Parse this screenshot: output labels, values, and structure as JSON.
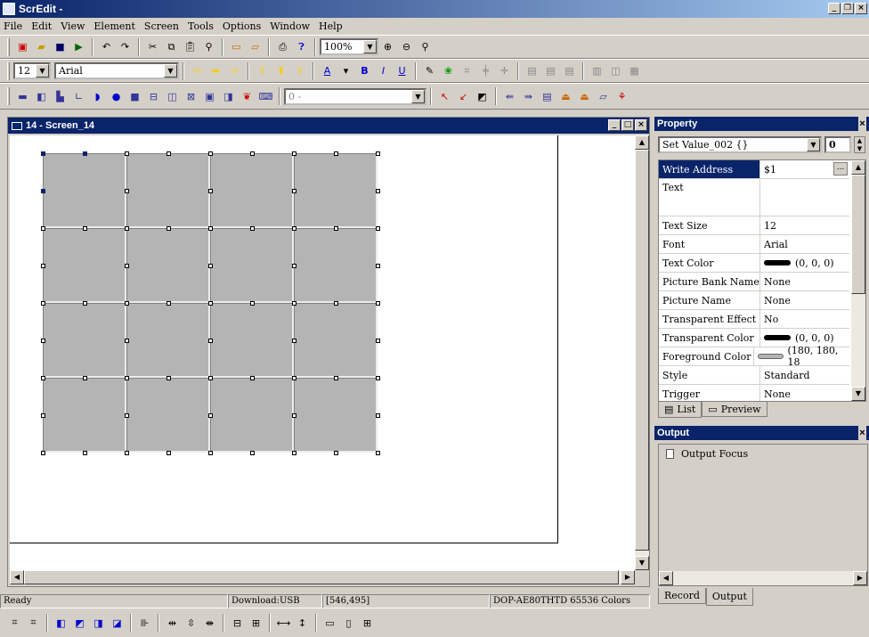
{
  "app": {
    "title": "ScrEdit -"
  },
  "menu": [
    "File",
    "Edit",
    "View",
    "Element",
    "Screen",
    "Tools",
    "Options",
    "Window",
    "Help"
  ],
  "toolbar1": {
    "zoom": "100%"
  },
  "toolbar2": {
    "font_size": "12",
    "font_name": "Arial"
  },
  "toolbar3": {
    "combo_value": "0 -"
  },
  "screen_window": {
    "title": "14 - Screen_14"
  },
  "property": {
    "title": "Property",
    "object": "Set Value_002 {}",
    "spin_value": "0",
    "rows": [
      {
        "key": "Write Address",
        "value": "$1"
      },
      {
        "key": "Text",
        "value": ""
      },
      {
        "key": "Text Size",
        "value": "12"
      },
      {
        "key": "Font",
        "value": "Arial"
      },
      {
        "key": "Text Color",
        "value": "(0, 0, 0)"
      },
      {
        "key": "Picture Bank Name",
        "value": "None"
      },
      {
        "key": "Picture Name",
        "value": "None"
      },
      {
        "key": "Transparent Effect",
        "value": "No"
      },
      {
        "key": "Transparent Color",
        "value": "(0, 0, 0)"
      },
      {
        "key": "Foreground Color",
        "value": "(180, 180, 18"
      },
      {
        "key": "Style",
        "value": "Standard"
      },
      {
        "key": "Trigger",
        "value": "None"
      }
    ],
    "tabs": {
      "list": "List",
      "preview": "Preview"
    }
  },
  "output": {
    "title": "Output",
    "item": "Output Focus",
    "tabs": {
      "record": "Record",
      "output": "Output"
    }
  },
  "status": {
    "ready": "Ready",
    "download": "Download:USB",
    "coords": "[546,495]",
    "device": "DOP-AE80THTD 65536 Colors"
  },
  "colors": {
    "title_bar": "#0a246a",
    "cell": "#b4b4b4",
    "foreground": "#b4b4b4"
  }
}
